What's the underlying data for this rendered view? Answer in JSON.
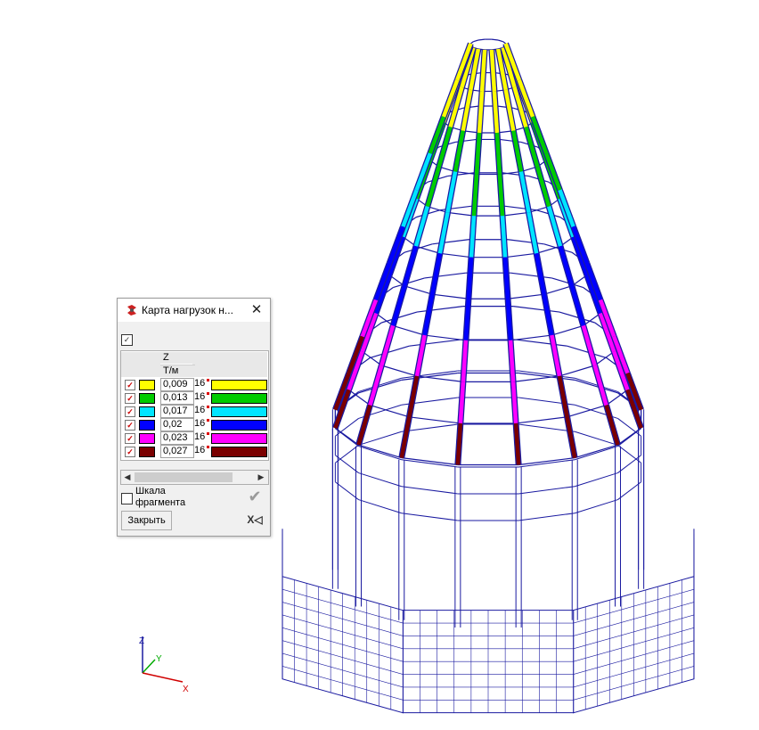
{
  "dialog": {
    "title": "Карта нагрузок н...",
    "close_glyph": "✕",
    "master_check_glyph": "✓",
    "column_header": "Z",
    "unit_header": "Т/м",
    "rows": [
      {
        "checked_glyph": "✓",
        "swatch_color": "#ffff00",
        "value": "0,009",
        "width": "16"
      },
      {
        "checked_glyph": "✓",
        "swatch_color": "#00cc00",
        "value": "0,013",
        "width": "16"
      },
      {
        "checked_glyph": "✓",
        "swatch_color": "#00e5ff",
        "value": "0,017",
        "width": "16"
      },
      {
        "checked_glyph": "✓",
        "swatch_color": "#0000ff",
        "value": "0,02",
        "width": "16"
      },
      {
        "checked_glyph": "✓",
        "swatch_color": "#ff00ff",
        "value": "0,023",
        "width": "16"
      },
      {
        "checked_glyph": "✓",
        "swatch_color": "#7a0000",
        "value": "0,027",
        "width": "16"
      }
    ],
    "scroll_left": "◀",
    "scroll_right": "▶",
    "fragment_scale_label": "Шкала фрагмента",
    "apply_glyph": "✔",
    "close_button_label": "Закрыть",
    "export_glyph": "X◁"
  },
  "axes": {
    "z": "Z",
    "y": "Y",
    "x": "X"
  },
  "colors": {
    "wireframe": "#1a1aa0",
    "load_levels": [
      "#ffff00",
      "#00cc00",
      "#00e5ff",
      "#0000ff",
      "#ff00ff",
      "#7a0000"
    ]
  },
  "model_icon": "structural-cone-model"
}
